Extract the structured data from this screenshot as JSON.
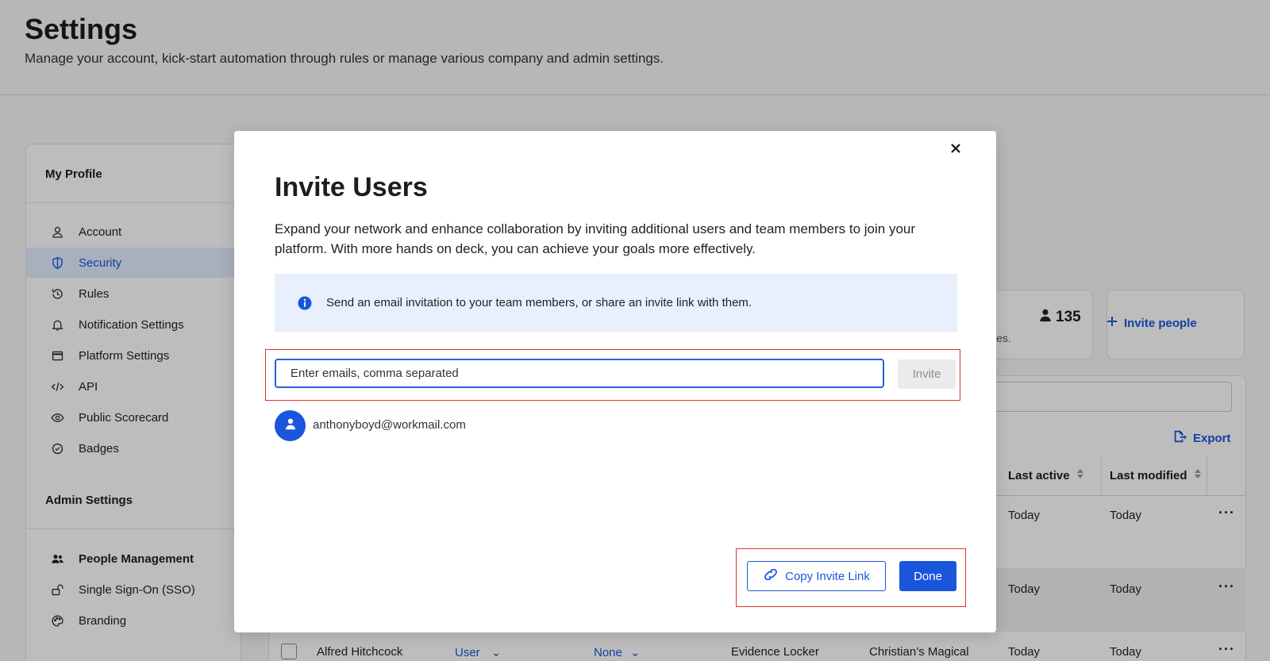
{
  "page": {
    "title": "Settings",
    "subtitle": "Manage your account, kick-start automation through rules or manage various company and admin settings."
  },
  "sidebar": {
    "my_profile_title": "My Profile",
    "profile_items": [
      {
        "label": "Account",
        "icon": "user-icon"
      },
      {
        "label": "Security",
        "icon": "shield-icon",
        "active": true
      },
      {
        "label": "Rules",
        "icon": "history-icon"
      },
      {
        "label": "Notification Settings",
        "icon": "bell-icon"
      },
      {
        "label": "Platform Settings",
        "icon": "window-icon"
      },
      {
        "label": "API",
        "icon": "code-icon"
      },
      {
        "label": "Public Scorecard",
        "icon": "eye-icon"
      },
      {
        "label": "Badges",
        "icon": "badge-icon"
      }
    ],
    "admin_title": "Admin Settings",
    "admin_items": [
      {
        "label": "People Management",
        "icon": "people-icon",
        "bold": true
      },
      {
        "label": "Single Sign-On (SSO)",
        "icon": "lock-open-icon"
      },
      {
        "label": "Branding",
        "icon": "palette-icon"
      }
    ]
  },
  "background": {
    "user_count": "135",
    "count_sub": "les.",
    "invite_people_label": "Invite people",
    "export_label": "Export",
    "columns": [
      "Last active",
      "Last modified"
    ],
    "rows": [
      {
        "last_active": "Today",
        "last_modified": "Today"
      },
      {
        "last_active": "Today",
        "last_modified": "Today"
      },
      {
        "name": "Alfred Hitchcock",
        "role": "User",
        "group": "None",
        "product": "Evidence Locker",
        "company": "Christian’s Magical",
        "last_active": "Today",
        "last_modified": "Today"
      }
    ],
    "more_label": "···"
  },
  "modal": {
    "title": "Invite Users",
    "description": "Expand your network and enhance collaboration by inviting additional users and team members to join your platform. With more hands on deck, you can achieve your goals more effectively.",
    "info_text": "Send an email invitation to your team members, or share an invite link with them.",
    "email_placeholder": "Enter emails, comma separated",
    "invite_label": "Invite",
    "invited_user_email": "anthonyboyd@workmail.com",
    "copy_link_label": "Copy Invite Link",
    "done_label": "Done"
  },
  "colors": {
    "primary": "#1a56db",
    "highlight": "#e1322e",
    "info_bg": "#e8f0fd"
  }
}
